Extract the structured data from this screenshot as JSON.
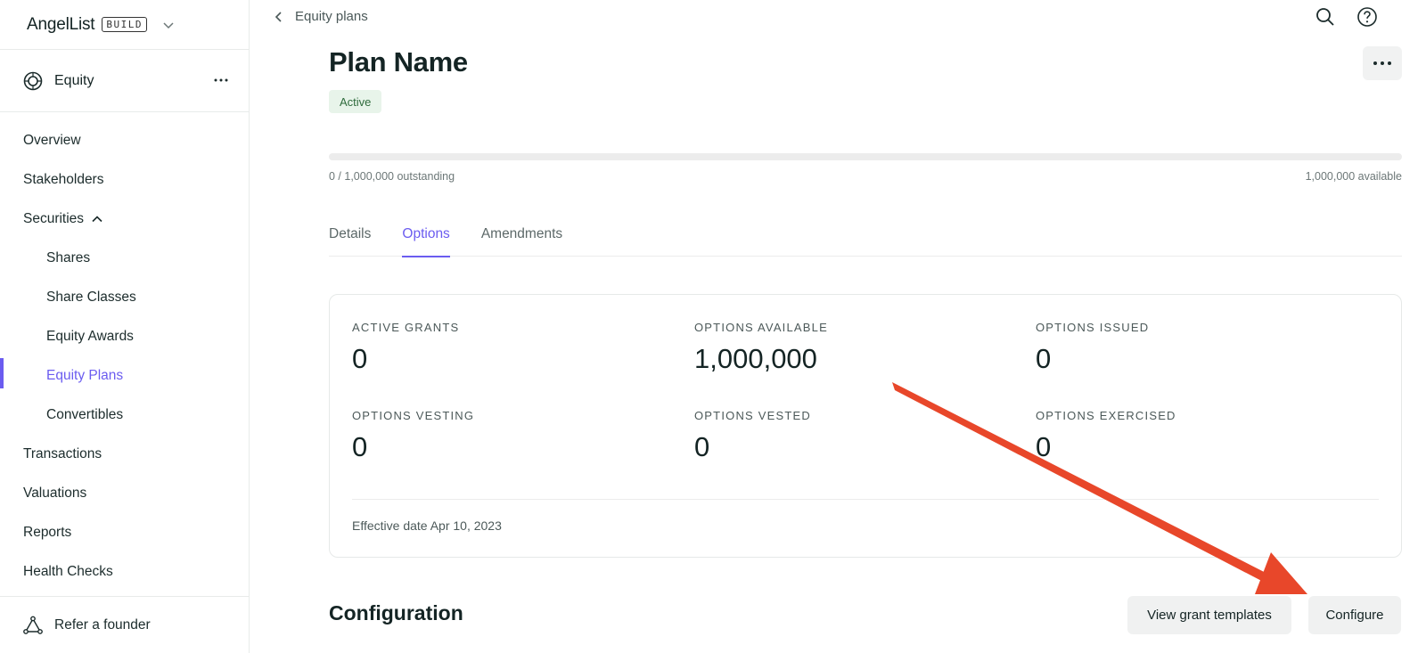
{
  "sidebar": {
    "brand": {
      "name": "AngelList",
      "tag": "BUILD"
    },
    "section": {
      "label": "Equity"
    },
    "items": [
      {
        "label": "Overview",
        "level": "top",
        "active": false
      },
      {
        "label": "Stakeholders",
        "level": "top",
        "active": false
      },
      {
        "label": "Securities",
        "level": "top",
        "active": false,
        "expanded": true
      },
      {
        "label": "Shares",
        "level": "sub",
        "active": false
      },
      {
        "label": "Share Classes",
        "level": "sub",
        "active": false
      },
      {
        "label": "Equity Awards",
        "level": "sub",
        "active": false
      },
      {
        "label": "Equity Plans",
        "level": "sub",
        "active": true
      },
      {
        "label": "Convertibles",
        "level": "sub",
        "active": false
      },
      {
        "label": "Transactions",
        "level": "top",
        "active": false
      },
      {
        "label": "Valuations",
        "level": "top",
        "active": false
      },
      {
        "label": "Reports",
        "level": "top",
        "active": false
      },
      {
        "label": "Health Checks",
        "level": "top",
        "active": false
      }
    ],
    "refer": {
      "label": "Refer a founder"
    }
  },
  "header": {
    "back_label": "Equity plans",
    "icons": [
      "search-icon",
      "help-icon"
    ]
  },
  "plan": {
    "title": "Plan Name",
    "status": "Active",
    "outstanding_text": "0 / 1,000,000 outstanding",
    "available_text": "1,000,000 available",
    "progress_fraction": 0
  },
  "tabs": [
    {
      "label": "Details",
      "active": false
    },
    {
      "label": "Options",
      "active": true
    },
    {
      "label": "Amendments",
      "active": false
    }
  ],
  "stats": [
    {
      "label": "ACTIVE GRANTS",
      "value": "0"
    },
    {
      "label": "OPTIONS AVAILABLE",
      "value": "1,000,000"
    },
    {
      "label": "OPTIONS ISSUED",
      "value": "0"
    },
    {
      "label": "OPTIONS VESTING",
      "value": "0"
    },
    {
      "label": "OPTIONS VESTED",
      "value": "0"
    },
    {
      "label": "OPTIONS EXERCISED",
      "value": "0"
    }
  ],
  "effective_date": "Effective date Apr 10, 2023",
  "configuration": {
    "title": "Configuration",
    "view_templates_label": "View grant templates",
    "configure_label": "Configure"
  },
  "colors": {
    "accent": "#6b5cf0",
    "active_badge_bg": "#e8f4ea",
    "active_badge_text": "#2f6b3c",
    "annotation_arrow": "#e8472a"
  }
}
